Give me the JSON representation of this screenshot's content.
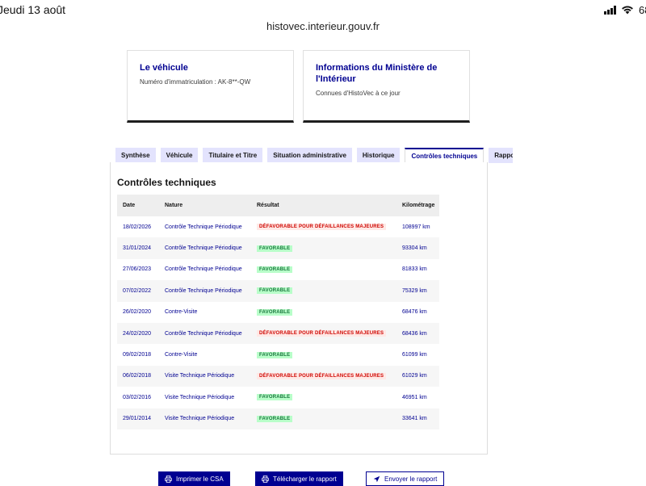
{
  "status_bar": {
    "date": "Jeudi 13 août",
    "battery": "68"
  },
  "browser": {
    "url": "histovec.interieur.gouv.fr"
  },
  "cards": {
    "vehicle": {
      "title": "Le véhicule",
      "subtitle": "Numéro d'immatriculation : AK-8**-QW"
    },
    "ministry": {
      "title": "Informations du Ministère de l'Intérieur",
      "subtitle": "Connues d'HistoVec à ce jour"
    }
  },
  "tabs": [
    {
      "label": "Synthèse"
    },
    {
      "label": "Véhicule"
    },
    {
      "label": "Titulaire et Titre"
    },
    {
      "label": "Situation administrative"
    },
    {
      "label": "Historique"
    },
    {
      "label": "Contrôles techniques",
      "active": true
    },
    {
      "label": "Rapport"
    }
  ],
  "section": {
    "title": "Contrôles techniques"
  },
  "table": {
    "headers": {
      "date": "Date",
      "nature": "Nature",
      "result": "Résultat",
      "km": "Kilométrage"
    },
    "rows": [
      {
        "date": "18/02/2026",
        "nature": "Contrôle Technique Périodique",
        "result": "DÉFAVORABLE POUR DÉFAILLANCES MAJEURES",
        "status": "defavorable",
        "km": "108997 km"
      },
      {
        "date": "31/01/2024",
        "nature": "Contrôle Technique Périodique",
        "result": "FAVORABLE",
        "status": "favorable",
        "km": "93304 km"
      },
      {
        "date": "27/06/2023",
        "nature": "Contrôle Technique Périodique",
        "result": "FAVORABLE",
        "status": "favorable",
        "km": "81833 km"
      },
      {
        "date": "07/02/2022",
        "nature": "Contrôle Technique Périodique",
        "result": "FAVORABLE",
        "status": "favorable",
        "km": "75329 km"
      },
      {
        "date": "26/02/2020",
        "nature": "Contre-Visite",
        "result": "FAVORABLE",
        "status": "favorable",
        "km": "68476 km"
      },
      {
        "date": "24/02/2020",
        "nature": "Contrôle Technique Périodique",
        "result": "DÉFAVORABLE POUR DÉFAILLANCES MAJEURES",
        "status": "defavorable",
        "km": "68436 km"
      },
      {
        "date": "09/02/2018",
        "nature": "Contre-Visite",
        "result": "FAVORABLE",
        "status": "favorable",
        "km": "61099 km"
      },
      {
        "date": "06/02/2018",
        "nature": "Visite Technique Périodique",
        "result": "DÉFAVORABLE POUR DÉFAILLANCES MAJEURES",
        "status": "defavorable",
        "km": "61029 km"
      },
      {
        "date": "03/02/2016",
        "nature": "Visite Technique Périodique",
        "result": "FAVORABLE",
        "status": "favorable",
        "km": "46951 km"
      },
      {
        "date": "29/01/2014",
        "nature": "Visite Technique Périodique",
        "result": "FAVORABLE",
        "status": "favorable",
        "km": "33641 km"
      }
    ]
  },
  "buttons": {
    "print": {
      "label": "Imprimer le CSA",
      "icon": "printer-icon"
    },
    "download": {
      "label": "Télécharger le rapport",
      "icon": "printer-icon"
    },
    "send": {
      "label": "Envoyer le rapport",
      "icon": "send-icon"
    }
  },
  "colors": {
    "primary": "#000091",
    "favorable": "#18753c",
    "defavorable": "#ce0500",
    "tab_bg": "#e3e3fd"
  }
}
